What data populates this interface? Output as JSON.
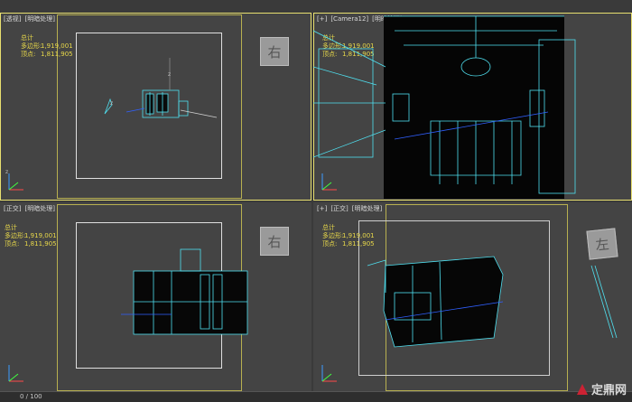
{
  "viewports": [
    {
      "labels": [
        "[透视]",
        "[明暗处理]"
      ],
      "view_cube": "",
      "active": true
    },
    {
      "labels": [
        "[+]",
        "[Camera12]",
        "[明暗处理]"
      ],
      "view_cube": "",
      "active": true
    },
    {
      "labels": [
        "[正交]",
        "[明暗处理]"
      ],
      "view_cube": "右",
      "active": false
    },
    {
      "labels": [
        "[+]",
        "[正交]",
        "[明暗处理]"
      ],
      "view_cube": "左",
      "active": false
    }
  ],
  "top_left_cube": "右",
  "stats": {
    "total_label": "总计",
    "poly_label": "多边形:",
    "poly_value": "1,919,001",
    "vert_label": "顶点:",
    "vert_value": "1,811,905"
  },
  "axes": {
    "x": "x",
    "y": "y",
    "z": "z"
  },
  "status": {
    "frame": "0 / 100"
  },
  "watermark": {
    "text": "定鼎网"
  },
  "colors": {
    "wire": "#4fe0f0",
    "highlight": "#e8e070",
    "text_yellow": "#e8d84a"
  }
}
